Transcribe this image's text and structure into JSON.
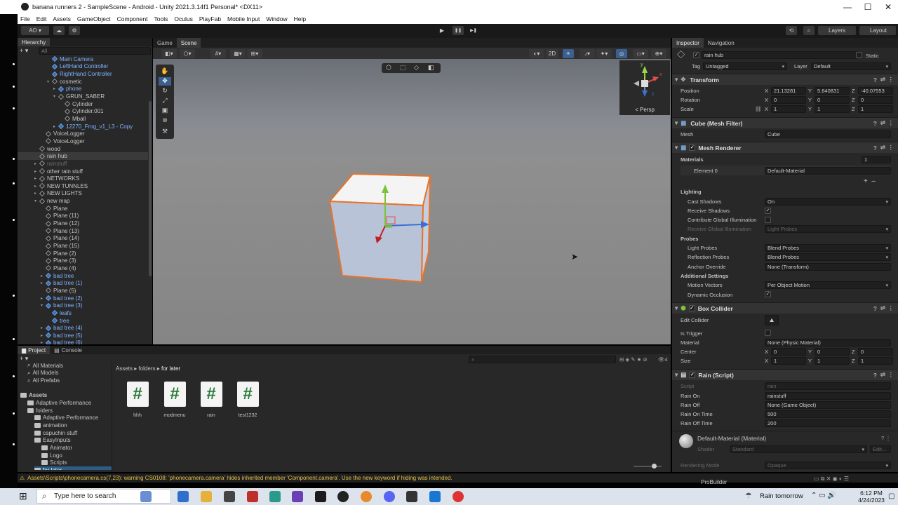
{
  "window": {
    "title": "banana runners 2 - SampleScene - Android - Unity 2021.3.14f1 Personal* <DX11>",
    "minimize": "—",
    "maximize": "☐",
    "close": "✕"
  },
  "menu": [
    "File",
    "Edit",
    "Assets",
    "GameObject",
    "Component",
    "Tools",
    "Oculus",
    "PlayFab",
    "Mobile Input",
    "Window",
    "Help"
  ],
  "toolbar": {
    "account": "AO ▾",
    "play": "▶",
    "pause": "❚❚",
    "step": "▶❚",
    "layers": "Layers",
    "layout": "Layout"
  },
  "hierarchy": {
    "tab": "Hierarchy",
    "search_placeholder": "All",
    "items": [
      {
        "label": "Main Camera",
        "indent": 4,
        "style": "blue"
      },
      {
        "label": "LeftHand Controller",
        "indent": 4,
        "style": "blue"
      },
      {
        "label": "RightHand Controller",
        "indent": 4,
        "style": "blue"
      },
      {
        "label": "cosmetic",
        "indent": 4,
        "style": "normal",
        "fold": "▾"
      },
      {
        "label": "phone",
        "indent": 5,
        "style": "blue",
        "fold": "▸"
      },
      {
        "label": "GRUN_SABER",
        "indent": 5,
        "style": "normal",
        "fold": "▾"
      },
      {
        "label": "Cylinder",
        "indent": 6,
        "style": "normal"
      },
      {
        "label": "Cylinder.001",
        "indent": 6,
        "style": "normal"
      },
      {
        "label": "Mball",
        "indent": 6,
        "style": "normal"
      },
      {
        "label": "12270_Frog_v1_L3 - Copy",
        "indent": 5,
        "style": "blue",
        "fold": "▸"
      },
      {
        "label": "VoiceLogger",
        "indent": 3,
        "style": "normal"
      },
      {
        "label": "VoiceLogger",
        "indent": 3,
        "style": "normal"
      },
      {
        "label": "wood",
        "indent": 2,
        "style": "normal"
      },
      {
        "label": "rain hub",
        "indent": 2,
        "style": "sel"
      },
      {
        "label": "rainstuff",
        "indent": 2,
        "style": "dim",
        "fold": "▸"
      },
      {
        "label": "other rain stuff",
        "indent": 2,
        "style": "normal",
        "fold": "▸"
      },
      {
        "label": "NETWORKS",
        "indent": 2,
        "style": "normal",
        "fold": "▸"
      },
      {
        "label": "NEW TUNNLES",
        "indent": 2,
        "style": "normal",
        "fold": "▸"
      },
      {
        "label": "NEW LIGHTS",
        "indent": 2,
        "style": "normal",
        "fold": "▸"
      },
      {
        "label": "new map",
        "indent": 2,
        "style": "normal",
        "fold": "▾"
      },
      {
        "label": "Plane",
        "indent": 3,
        "style": "normal"
      },
      {
        "label": "Plane (11)",
        "indent": 3,
        "style": "normal"
      },
      {
        "label": "Plane (12)",
        "indent": 3,
        "style": "normal"
      },
      {
        "label": "Plane (13)",
        "indent": 3,
        "style": "normal"
      },
      {
        "label": "Plane (14)",
        "indent": 3,
        "style": "normal"
      },
      {
        "label": "Plane (15)",
        "indent": 3,
        "style": "normal"
      },
      {
        "label": "Plane (2)",
        "indent": 3,
        "style": "normal"
      },
      {
        "label": "Plane (3)",
        "indent": 3,
        "style": "normal"
      },
      {
        "label": "Plane (4)",
        "indent": 3,
        "style": "normal"
      },
      {
        "label": "bad tree",
        "indent": 3,
        "style": "blue",
        "fold": "▸"
      },
      {
        "label": "bad tree (1)",
        "indent": 3,
        "style": "blue",
        "fold": "▸"
      },
      {
        "label": "Plane (5)",
        "indent": 3,
        "style": "normal"
      },
      {
        "label": "bad tree (2)",
        "indent": 3,
        "style": "blue",
        "fold": "▸"
      },
      {
        "label": "bad tree (3)",
        "indent": 3,
        "style": "blue",
        "fold": "▾"
      },
      {
        "label": "leafs",
        "indent": 4,
        "style": "blue"
      },
      {
        "label": "tree",
        "indent": 4,
        "style": "blue"
      },
      {
        "label": "bad tree (4)",
        "indent": 3,
        "style": "blue",
        "fold": "▸"
      },
      {
        "label": "bad tree (5)",
        "indent": 3,
        "style": "blue",
        "fold": "▸"
      },
      {
        "label": "bad tree (6)",
        "indent": 3,
        "style": "blue",
        "fold": "▸"
      }
    ]
  },
  "scene": {
    "tabs": [
      "Game",
      "Scene"
    ],
    "mode_2d": "2D",
    "persp": "< Persp",
    "gizmo_y": "y",
    "gizmo_x": "x",
    "gizmo_z": "z"
  },
  "inspector": {
    "tabs": [
      "Inspector",
      "Navigation"
    ],
    "object_name": "rain hub",
    "static": "Static",
    "tag_label": "Tag",
    "tag_value": "Untagged",
    "layer_label": "Layer",
    "layer_value": "Default",
    "transform": {
      "title": "Transform",
      "position_label": "Position",
      "pos": [
        "21.13281",
        "5.640831",
        "-40.07553"
      ],
      "rotation_label": "Rotation",
      "rot": [
        "0",
        "0",
        "0"
      ],
      "scale_label": "Scale",
      "scale": [
        "1",
        "1",
        "1"
      ]
    },
    "mesh_filter": {
      "title": "Cube (Mesh Filter)",
      "mesh_label": "Mesh",
      "mesh_value": "Cube"
    },
    "mesh_renderer": {
      "title": "Mesh Renderer",
      "materials_label": "Materials",
      "materials_count": "1",
      "element0_label": "Element 0",
      "element0_value": "Default-Material",
      "lighting": "Lighting",
      "cast_shadows_label": "Cast Shadows",
      "cast_shadows": "On",
      "receive_shadows_label": "Receive Shadows",
      "contribute_gi_label": "Contribute Global Illumination",
      "receive_gi_label": "Receive Global Illumination",
      "receive_gi": "Light Probes",
      "probes": "Probes",
      "light_probes_label": "Light Probes",
      "light_probes": "Blend Probes",
      "reflection_probes_label": "Reflection Probes",
      "reflection_probes": "Blend Probes",
      "anchor_label": "Anchor Override",
      "anchor": "None (Transform)",
      "additional": "Additional Settings",
      "motion_vectors_label": "Motion Vectors",
      "motion_vectors": "Per Object Motion",
      "dynamic_occlusion_label": "Dynamic Occlusion"
    },
    "box_collider": {
      "title": "Box Collider",
      "edit_label": "Edit Collider",
      "trigger_label": "Is Trigger",
      "material_label": "Material",
      "material": "None (Physic Material)",
      "center_label": "Center",
      "center": [
        "0",
        "0",
        "0"
      ],
      "size_label": "Size",
      "size": [
        "1",
        "1",
        "1"
      ]
    },
    "rain_script": {
      "title": "Rain (Script)",
      "script_label": "Script",
      "script": "rain",
      "rain_on_label": "Rain On",
      "rain_on": "rainstuff",
      "rain_off_label": "Rain Off",
      "rain_off": "None (Game Object)",
      "rain_on_time_label": "Rain On Time",
      "rain_on_time": "500",
      "rain_off_time_label": "Rain Off Time",
      "rain_off_time": "200"
    },
    "material": {
      "title": "Default-Material (Material)",
      "shader_label": "Shader",
      "shader": "Standard",
      "edit": "Edit...",
      "rendering_mode_label": "Rendering Mode",
      "rendering_mode": "Opaque"
    }
  },
  "project": {
    "tabs": [
      "Project",
      "Console"
    ],
    "breadcrumb": [
      "Assets",
      "folders",
      "for later"
    ],
    "tree": [
      {
        "label": "All Materials",
        "indent": 1,
        "kind": "search"
      },
      {
        "label": "All Models",
        "indent": 1,
        "kind": "search"
      },
      {
        "label": "All Prefabs",
        "indent": 1,
        "kind": "search"
      },
      {
        "label": "",
        "indent": 0,
        "kind": "gap"
      },
      {
        "label": "Assets",
        "indent": 0,
        "kind": "bold"
      },
      {
        "label": "Adaptive Performance",
        "indent": 1,
        "kind": "folder"
      },
      {
        "label": "folders",
        "indent": 1,
        "kind": "folder"
      },
      {
        "label": "Adaptive Performance",
        "indent": 2,
        "kind": "folder"
      },
      {
        "label": "animation",
        "indent": 2,
        "kind": "folder"
      },
      {
        "label": "capuchin stuff",
        "indent": 2,
        "kind": "folder"
      },
      {
        "label": "EasyInputs",
        "indent": 2,
        "kind": "folder"
      },
      {
        "label": "Animator",
        "indent": 3,
        "kind": "folder"
      },
      {
        "label": "Logo",
        "indent": 3,
        "kind": "folder"
      },
      {
        "label": "Scripts",
        "indent": 3,
        "kind": "folder"
      },
      {
        "label": "for later",
        "indent": 2,
        "kind": "folder-sel"
      }
    ],
    "assets": [
      "hhh",
      "modmenu",
      "rain",
      "test1232"
    ],
    "badge_count": "4"
  },
  "status": {
    "warning": "Assets\\Scripts\\phonecamera.cs(7,23): warning CS0108: 'phonecamera.camera' hides inherited member 'Component.camera'. Use the new keyword if hiding was intended.",
    "probuilder": "ProBuilder"
  },
  "taskbar": {
    "search_placeholder": "Type here to search",
    "weather": "Rain tomorrow",
    "time": "6:12 PM",
    "date": "4/24/2023"
  },
  "colors": {
    "selection_outline": "#e8732a",
    "prefab_blue": "#7fb3ff",
    "warning_yellow": "#e7c34a"
  }
}
